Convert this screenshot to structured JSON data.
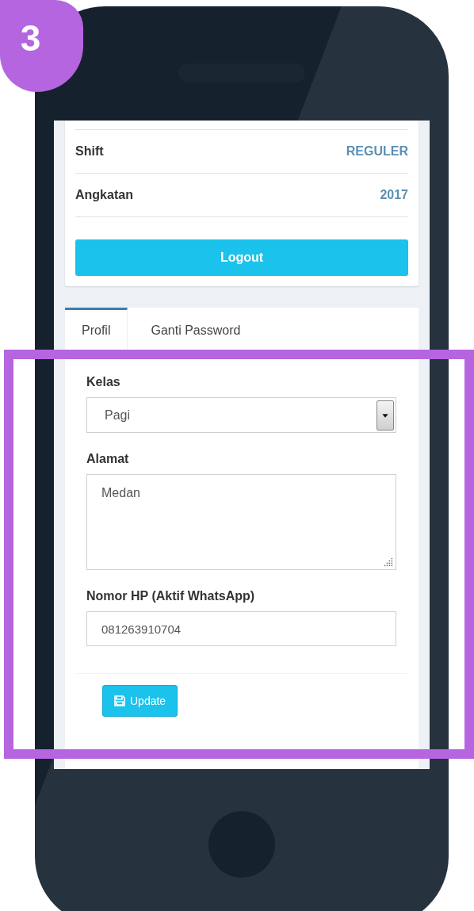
{
  "step_badge": "3",
  "info_rows": [
    {
      "label": "Shift",
      "value": "REGULER"
    },
    {
      "label": "Angkatan",
      "value": "2017"
    }
  ],
  "logout_button": "Logout",
  "tabs": [
    {
      "label": "Profil",
      "selected": true
    },
    {
      "label": "Ganti Password",
      "selected": false
    }
  ],
  "form": {
    "fields": [
      {
        "kind": "select",
        "label": "Kelas",
        "value": "Pagi"
      },
      {
        "kind": "textarea",
        "label": "Alamat",
        "value": "Medan"
      },
      {
        "kind": "text",
        "label": "Nomor HP (Aktif WhatsApp)",
        "value": "081263910704"
      }
    ],
    "submit_button": "Update"
  }
}
